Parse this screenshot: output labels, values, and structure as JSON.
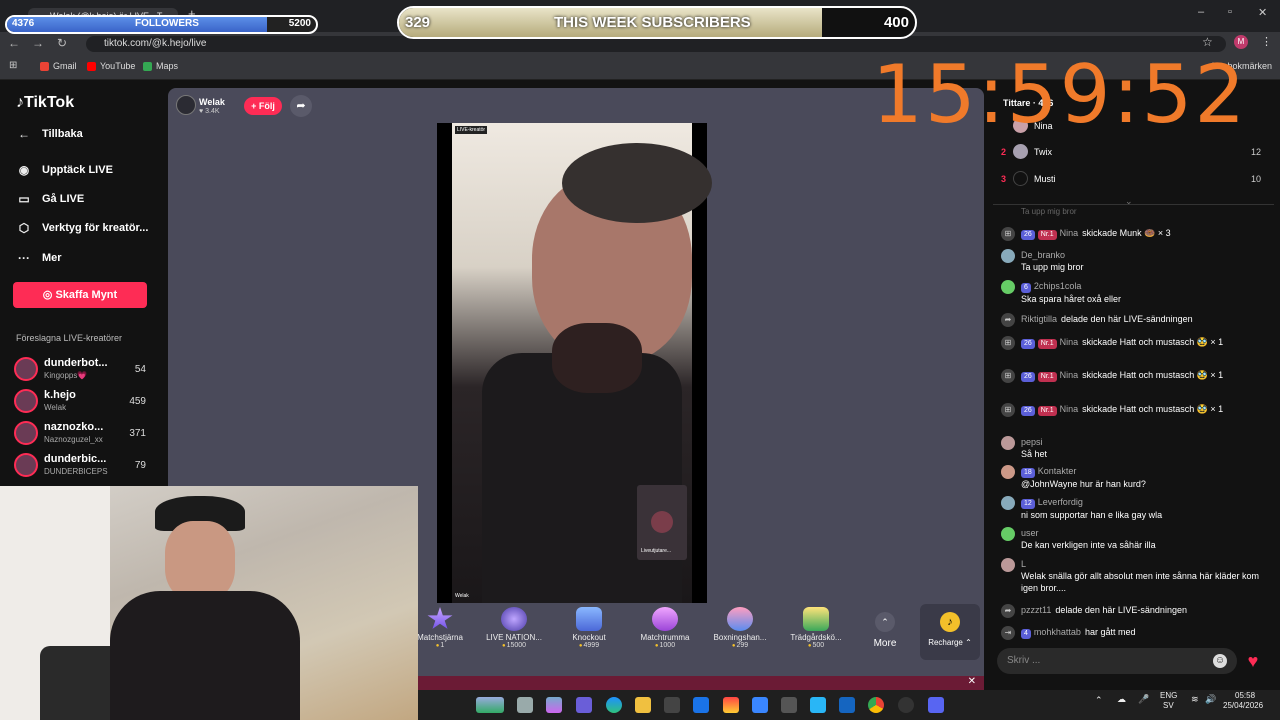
{
  "browser": {
    "tab_title": "Welak (@k.hejo) är LIVE - T...",
    "url": "tiktok.com/@k.hejo/live",
    "profile_initial": "M",
    "bookmarks": [
      "Gmail",
      "YouTube",
      "Maps"
    ],
    "all_bookmarks": "Alla bokmärken"
  },
  "overlay": {
    "followers_current": "4376",
    "followers_label": "FOLLOWERS",
    "followers_goal": "5200",
    "followers_progress": 0.84,
    "subs_current": "329",
    "subs_label": "THIS WEEK SUBSCRIBERS",
    "subs_goal": "400",
    "subs_progress": 0.82,
    "clock": "15:59:52"
  },
  "sidebar": {
    "logo": "TikTok",
    "back": "Tillbaka",
    "items": [
      {
        "label": "Upptäck LIVE",
        "icon": "live-icon"
      },
      {
        "label": "Gå LIVE",
        "icon": "camera-icon"
      },
      {
        "label": "Verktyg för kreatör...",
        "icon": "tools-icon"
      },
      {
        "label": "Mer",
        "icon": "more-icon"
      }
    ],
    "coins_button": "Skaffa Mynt",
    "suggested_title": "Föreslagna LIVE-kreatörer",
    "creators": [
      {
        "name": "dunderbot...",
        "sub": "Kingopps💗",
        "count": "54"
      },
      {
        "name": "k.hejo",
        "sub": "Welak",
        "count": "459"
      },
      {
        "name": "naznozko...",
        "sub": "Naznozguzel_xx",
        "count": "371"
      },
      {
        "name": "dunderbic...",
        "sub": "DUNDERBICEPS",
        "count": "79"
      }
    ]
  },
  "stream": {
    "host_name": "Welak",
    "host_likes": "3.4K",
    "follow_label": "+ Följ",
    "video_tag": "LIVE-kreatör",
    "pip_label": "Liveutjutare...",
    "host_footer": "Welak"
  },
  "gifts": [
    {
      "name": "Matchstjärna",
      "price": "1"
    },
    {
      "name": "LIVE NATION...",
      "price": "15000"
    },
    {
      "name": "Knockout",
      "price": "4999"
    },
    {
      "name": "Matchtrumma",
      "price": "1000"
    },
    {
      "name": "Boxningshan...",
      "price": "299"
    },
    {
      "name": "Trädgårdskö...",
      "price": "500"
    }
  ],
  "gift_bar": {
    "more": "More",
    "recharge": "Recharge"
  },
  "chat": {
    "viewers_label": "Tittare · 456",
    "ranking": [
      {
        "rank": "",
        "name": "Nina",
        "points": ""
      },
      {
        "rank": "2",
        "name": "Twix",
        "points": "12"
      },
      {
        "rank": "3",
        "name": "Musti",
        "points": "10"
      }
    ],
    "clipped_line": "Ta upp mig bror",
    "messages": [
      {
        "user": "Nina",
        "level": "26",
        "fan": "Nr.1",
        "text": "skickade Munk 🍩 × 3",
        "icon": "gift-icon"
      },
      {
        "user": "De_branko",
        "level": "",
        "fan": "",
        "text": "Ta upp mig bror",
        "icon": "avatar-icon"
      },
      {
        "user": "2chips1cola",
        "level": "6",
        "fan": "",
        "text": "Ska spara håret oxå eller",
        "icon": "avatar-icon"
      },
      {
        "user": "Riktigtilla",
        "level": "",
        "fan": "",
        "text": "delade den här LIVE-sändningen",
        "icon": "share-icon"
      },
      {
        "user": "Nina",
        "level": "26",
        "fan": "Nr.1",
        "text": "skickade Hatt och mustasch 🥸 × 1",
        "icon": "gift-icon"
      },
      {
        "user": "Nina",
        "level": "26",
        "fan": "Nr.1",
        "text": "skickade Hatt och mustasch 🥸 × 1",
        "icon": "gift-icon"
      },
      {
        "user": "Nina",
        "level": "26",
        "fan": "Nr.1",
        "text": "skickade Hatt och mustasch 🥸 × 1",
        "icon": "gift-icon"
      },
      {
        "user": "pepsi",
        "level": "",
        "fan": "",
        "text": "Så het",
        "icon": "avatar-icon"
      },
      {
        "user": "Kontakter",
        "level": "18",
        "fan": "",
        "text": "@JohnWayne hur är han kurd?",
        "icon": "avatar-icon"
      },
      {
        "user": "Leverfordig",
        "level": "12",
        "fan": "",
        "text": "ni som supportar han e lika gay wla",
        "icon": "avatar-icon"
      },
      {
        "user": "user",
        "level": "",
        "fan": "",
        "text": "De kan verkligen inte va såhär illa",
        "icon": "avatar-icon"
      },
      {
        "user": "L",
        "level": "",
        "fan": "",
        "text": "Welak snälla gör allt absolut men inte sånna här kläder kom igen bror....",
        "icon": "avatar-icon"
      },
      {
        "user": "pzzzt11",
        "level": "",
        "fan": "",
        "text": "delade den här LIVE-sändningen",
        "icon": "share-icon"
      },
      {
        "user": "mohkhattab",
        "level": "4",
        "fan": "",
        "text": "har gått med",
        "icon": "join-icon"
      }
    ],
    "input_placeholder": "Skriv ..."
  },
  "taskbar": {
    "lang1": "ENG",
    "lang2": "SV",
    "time": "05:58",
    "date": "25/04/2026"
  }
}
